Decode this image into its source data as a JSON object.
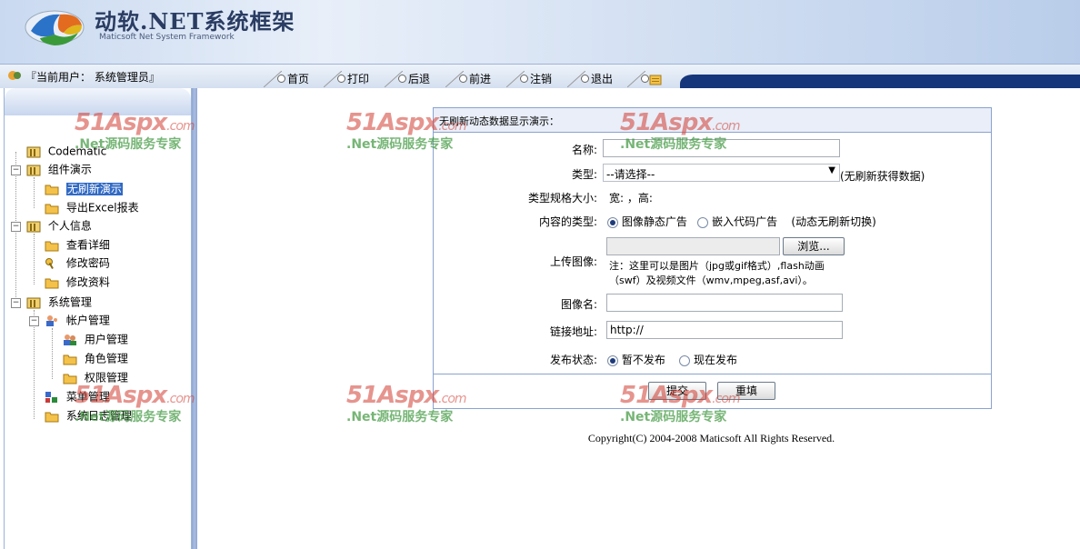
{
  "header": {
    "title": "动软.NET系统框架",
    "subtitle": "Maticsoft Net System Framework"
  },
  "navbar": {
    "user_label": "『当前用户： 系统管理员』",
    "items": [
      {
        "label": "首页"
      },
      {
        "label": "打印"
      },
      {
        "label": "后退"
      },
      {
        "label": "前进"
      },
      {
        "label": "注销"
      },
      {
        "label": "退出"
      }
    ]
  },
  "tree": [
    {
      "label": "Codematic"
    },
    {
      "label": "组件演示"
    },
    {
      "label": "无刷新演示"
    },
    {
      "label": "导出Excel报表"
    },
    {
      "label": "个人信息"
    },
    {
      "label": "查看详细"
    },
    {
      "label": "修改密码"
    },
    {
      "label": "修改资料"
    },
    {
      "label": "系统管理"
    },
    {
      "label": "帐户管理"
    },
    {
      "label": "用户管理"
    },
    {
      "label": "角色管理"
    },
    {
      "label": "权限管理"
    },
    {
      "label": "菜单管理"
    },
    {
      "label": "系统日志管理"
    }
  ],
  "form": {
    "title": "无刷新动态数据显示演示：",
    "name_label": "名称:",
    "name_value": "",
    "type_label": "类型:",
    "type_value": "--请选择--",
    "type_note": "(无刷新获得数据)",
    "size_label": "类型规格大小:",
    "size_value": "宽: ，高:",
    "content_label": "内容的类型:",
    "content_opt1": "图像静态广告",
    "content_opt2": "嵌入代码广告",
    "content_note": "(动态无刷新切换)",
    "upload_label": "上传图像:",
    "browse_label": "浏览...",
    "upload_note1": "注：这里可以是图片（jpg或gif格式）,flash动画",
    "upload_note2": "（swf）及视频文件（wmv,mpeg,asf,avi）。",
    "imgname_label": "图像名:",
    "imgname_value": "",
    "link_label": "链接地址:",
    "link_value": "http://",
    "publish_label": "发布状态:",
    "publish_opt1": "暂不发布",
    "publish_opt2": "现在发布",
    "submit_label": "提交",
    "reset_label": "重填"
  },
  "copyright": "Copyright(C) 2004-2008 Maticsoft All Rights Reserved.",
  "watermark": {
    "brand": "51Aspx",
    "domain": ".com",
    "slogan": ".Net源码服务专家"
  },
  "colors": {
    "nav_dark": "#15367a",
    "selected": "#316ac5",
    "panel_border": "#8aa3cf"
  }
}
